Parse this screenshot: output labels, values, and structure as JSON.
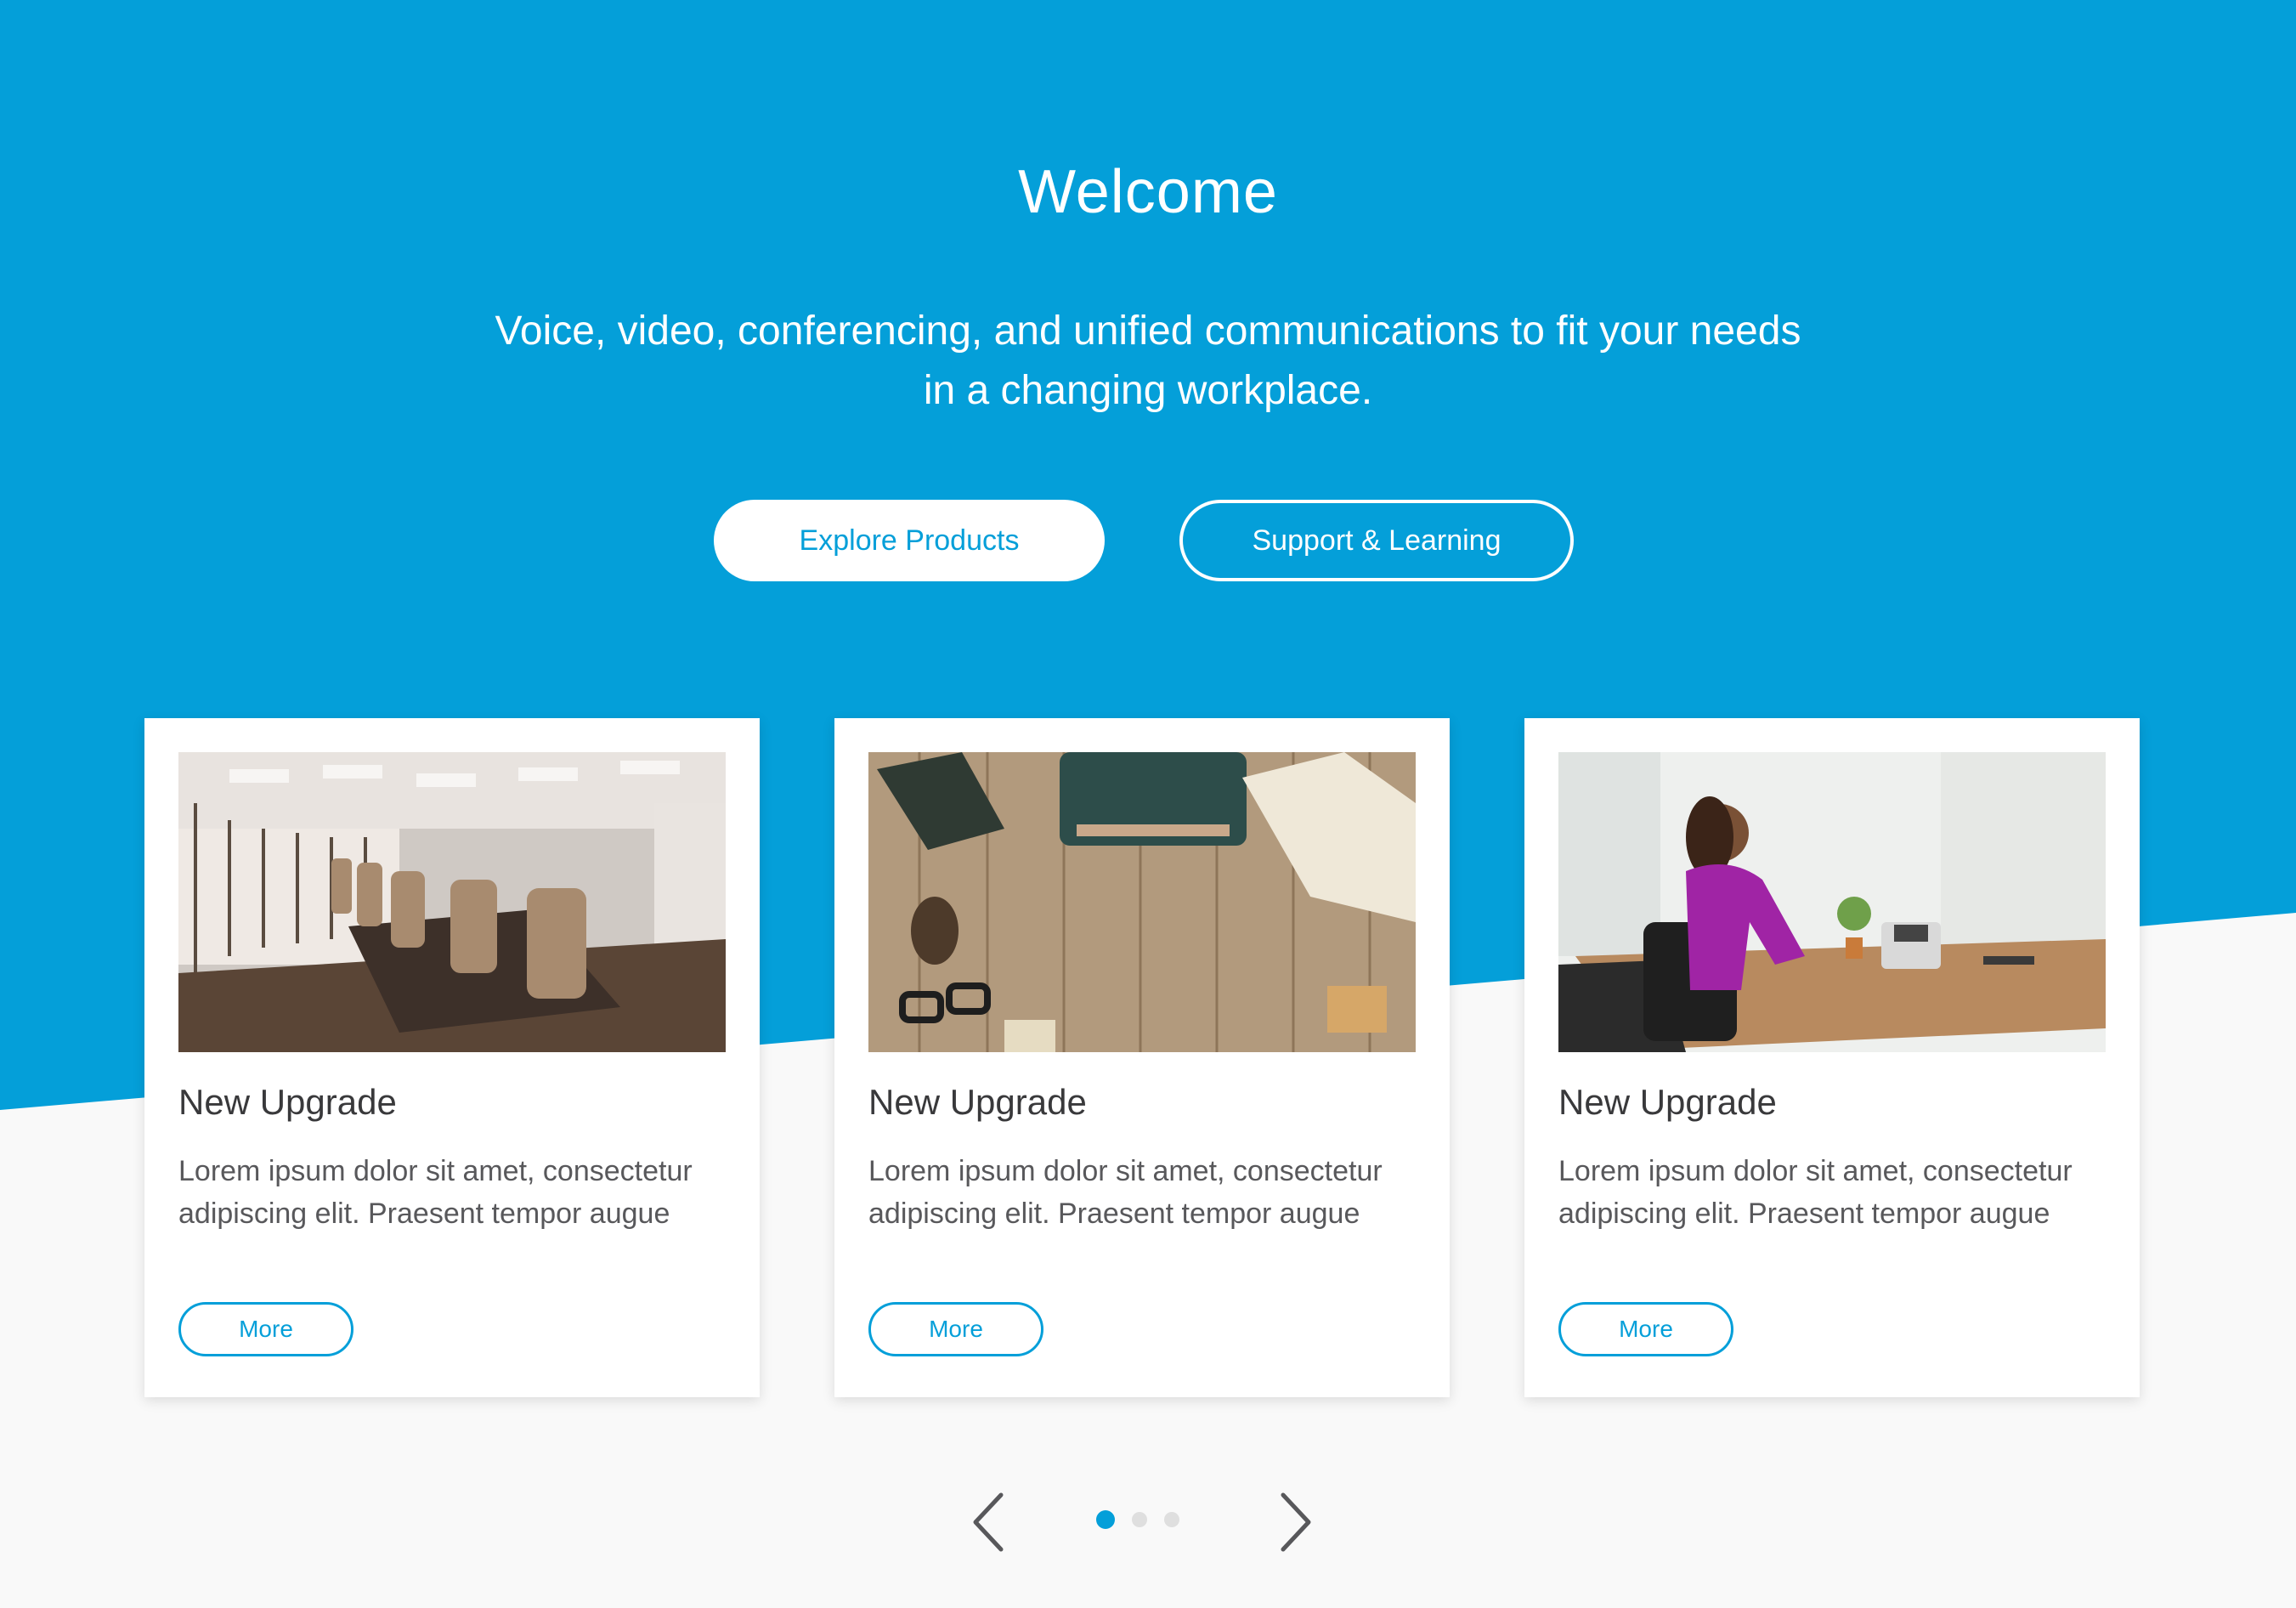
{
  "colors": {
    "brand": "#049fd9",
    "page_bg": "#f9f9f9",
    "text_dark": "#39393b",
    "text_body": "#58585b"
  },
  "hero": {
    "title": "Welcome",
    "subtitle_line1": "Voice, video, conferencing, and unified communications to fit your needs",
    "subtitle_line2": "in a changing workplace.",
    "primary_button": "Explore Products",
    "secondary_button": "Support & Learning"
  },
  "cards": [
    {
      "image": "conference-room-photo",
      "title": "New Upgrade",
      "text": "Lorem ipsum dolor sit amet, consectetur adipiscing elit. Praesent tempor augue",
      "button": "More"
    },
    {
      "image": "typewriter-desk-photo",
      "title": "New Upgrade",
      "text": "Lorem ipsum dolor sit amet, consectetur adipiscing elit. Praesent tempor augue",
      "button": "More"
    },
    {
      "image": "woman-on-phone-photo",
      "title": "New Upgrade",
      "text": "Lorem ipsum dolor sit amet, consectetur adipiscing elit. Praesent tempor augue",
      "button": "More"
    }
  ],
  "carousel": {
    "prev_icon": "chevron-left-icon",
    "next_icon": "chevron-right-icon",
    "page_count": 3,
    "active_page": 1
  }
}
